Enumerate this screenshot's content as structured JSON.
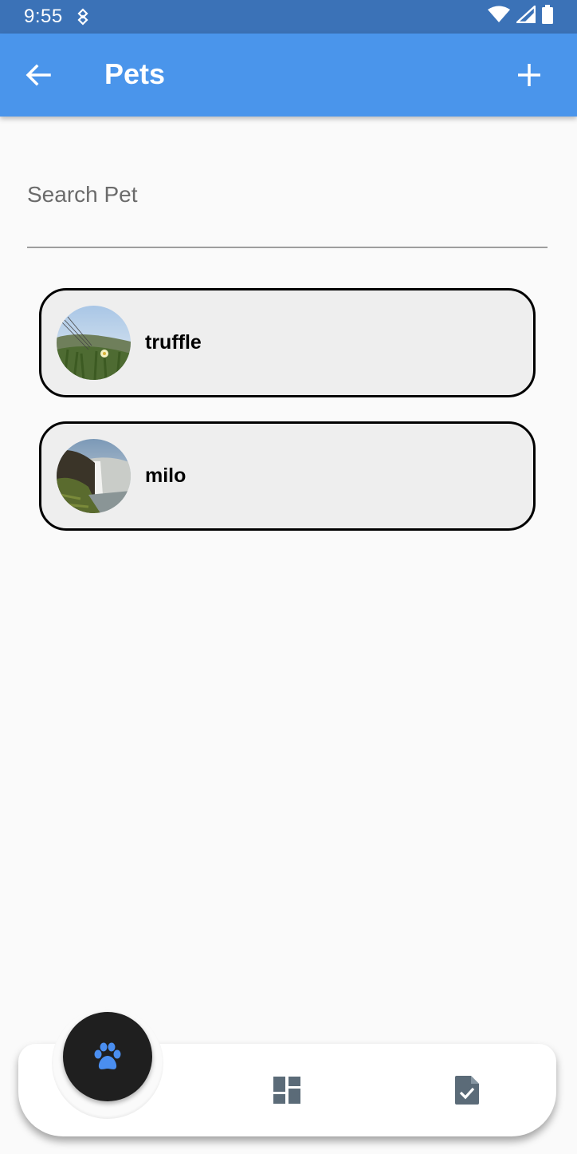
{
  "status_bar": {
    "time": "9:55",
    "icons": [
      "notification-icon",
      "wifi-icon",
      "cell-signal-icon",
      "battery-icon"
    ]
  },
  "app_bar": {
    "title": "Pets",
    "back_icon": "arrow-left-icon",
    "add_icon": "plus-icon",
    "color": "#4a95eb"
  },
  "search": {
    "placeholder": "Search Pet",
    "value": ""
  },
  "pets": [
    {
      "name": "truffle",
      "avatar": "grass-flower-photo"
    },
    {
      "name": "milo",
      "avatar": "waterfall-photo"
    }
  ],
  "bottom_nav": {
    "items": [
      {
        "icon": "paw-icon",
        "active": true
      },
      {
        "icon": "dashboard-icon",
        "active": false
      },
      {
        "icon": "task-file-icon",
        "active": false
      }
    ],
    "active_color": "#4a8ef0",
    "inactive_color": "#5b6b78"
  }
}
